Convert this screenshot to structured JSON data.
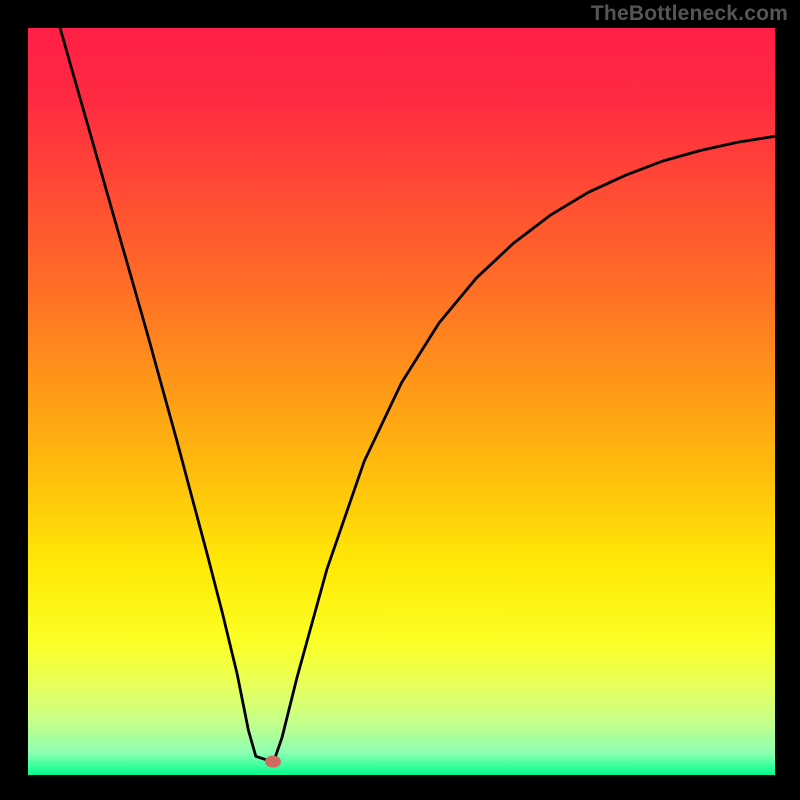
{
  "attribution": "TheBottleneck.com",
  "chart_data": {
    "type": "line",
    "title": "",
    "xlabel": "",
    "ylabel": "",
    "xlim": [
      0,
      1
    ],
    "ylim": [
      0,
      1
    ],
    "background_gradient": {
      "stops": [
        {
          "offset": 0.0,
          "color": "#ff1f47"
        },
        {
          "offset": 0.1,
          "color": "#ff2b41"
        },
        {
          "offset": 0.22,
          "color": "#ff4b34"
        },
        {
          "offset": 0.35,
          "color": "#ff6f26"
        },
        {
          "offset": 0.48,
          "color": "#ff9818"
        },
        {
          "offset": 0.6,
          "color": "#ffbf0c"
        },
        {
          "offset": 0.72,
          "color": "#ffe906"
        },
        {
          "offset": 0.82,
          "color": "#fbff24"
        },
        {
          "offset": 0.88,
          "color": "#e8ff5a"
        },
        {
          "offset": 0.93,
          "color": "#c4ff8a"
        },
        {
          "offset": 0.97,
          "color": "#8cffb2"
        },
        {
          "offset": 1.0,
          "color": "#00ff8e"
        }
      ]
    },
    "series": [
      {
        "name": "curve",
        "x": [
          0.043,
          0.06,
          0.08,
          0.1,
          0.12,
          0.14,
          0.16,
          0.18,
          0.2,
          0.22,
          0.24,
          0.26,
          0.28,
          0.295,
          0.305,
          0.32,
          0.325,
          0.33,
          0.34,
          0.36,
          0.4,
          0.45,
          0.5,
          0.55,
          0.6,
          0.65,
          0.7,
          0.75,
          0.8,
          0.85,
          0.9,
          0.95,
          1.0
        ],
        "y": [
          1.0,
          0.94,
          0.87,
          0.8,
          0.73,
          0.66,
          0.59,
          0.517,
          0.445,
          0.37,
          0.295,
          0.218,
          0.135,
          0.06,
          0.025,
          0.02,
          0.02,
          0.021,
          0.05,
          0.13,
          0.275,
          0.42,
          0.525,
          0.605,
          0.665,
          0.712,
          0.75,
          0.78,
          0.803,
          0.822,
          0.836,
          0.847,
          0.855
        ]
      }
    ],
    "marker": {
      "x": 0.328,
      "y": 0.018,
      "color": "#d16a60"
    }
  }
}
